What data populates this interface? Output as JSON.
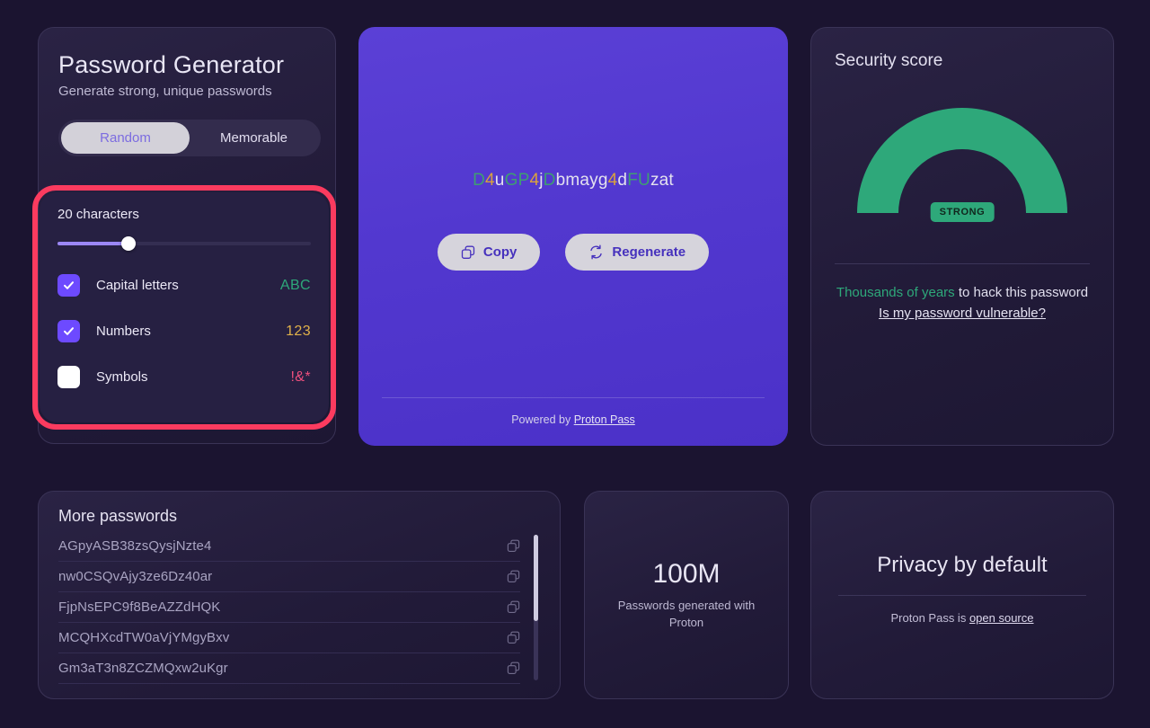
{
  "generator": {
    "title": "Password Generator",
    "subtitle": "Generate strong, unique passwords",
    "modes": [
      {
        "label": "Random",
        "active": true
      },
      {
        "label": "Memorable",
        "active": false
      }
    ],
    "length_label": "20 characters",
    "length_value": 20,
    "slider_percent": 28,
    "options": [
      {
        "name": "capital-letters",
        "label": "Capital letters",
        "sample": "ABC",
        "sample_color": "#2ea87a",
        "checked": true
      },
      {
        "name": "numbers",
        "label": "Numbers",
        "sample": "123",
        "sample_color": "#e0b14a",
        "checked": true
      },
      {
        "name": "symbols",
        "label": "Symbols",
        "sample": "!&*",
        "sample_color": "#ef4f7e",
        "checked": false
      }
    ],
    "highlight_color": "#fb3b5f"
  },
  "password_card": {
    "password": "D4uGP4jDbmayg4dFUzat",
    "copy_label": "Copy",
    "regenerate_label": "Regenerate",
    "footer_prefix": "Powered by ",
    "footer_link": "Proton Pass",
    "colors": {
      "upper": "#3f9e72",
      "digit": "#d9a23c",
      "lower": "#e4e2ee",
      "card": "#5238cf"
    }
  },
  "security": {
    "title": "Security score",
    "badge": "STRONG",
    "gauge_percent": 100,
    "gauge_color": "#2ea87a",
    "crack_time_highlight": "Thousands of years",
    "crack_time_rest": " to hack this password",
    "vulnerable_link": "Is my password vulnerable?"
  },
  "more_passwords": {
    "title": "More passwords",
    "items": [
      "AGpyASB38zsQysjNzte4",
      "nw0CSQvAjy3ze6Dz40ar",
      "FjpNsEPC9f8BeAZZdHQK",
      "MCQHXcdTW0aVjYMgyBxv",
      "Gm3aT3n8ZCZMQxw2uKgr"
    ]
  },
  "stat": {
    "value": "100M",
    "label": "Passwords generated with Proton"
  },
  "privacy": {
    "title": "Privacy by default",
    "sub_prefix": "Proton Pass is ",
    "sub_link": "open source"
  }
}
